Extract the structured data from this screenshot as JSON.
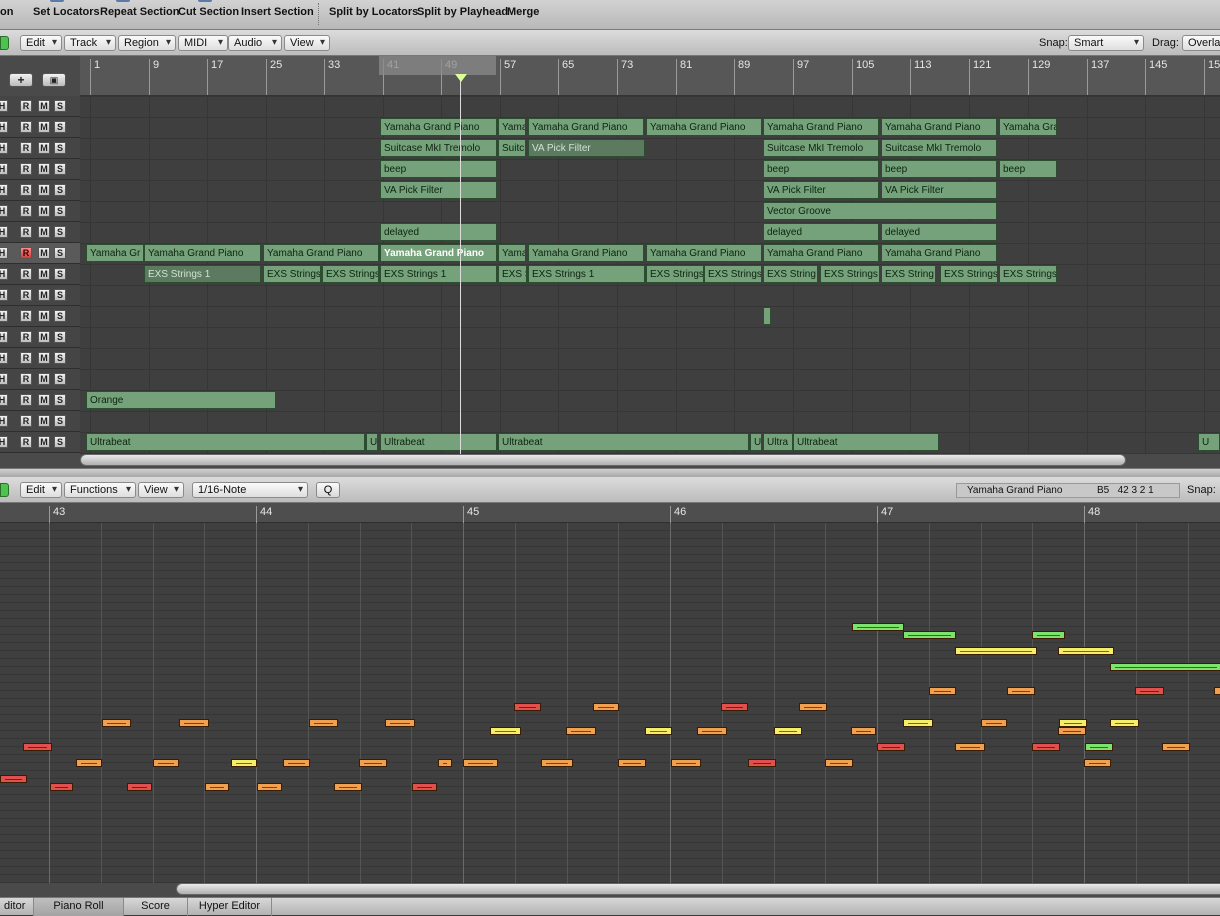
{
  "toolbar": {
    "items": [
      "on",
      "Set Locators",
      "Repeat Section",
      "Cut Section",
      "Insert Section",
      "Split by Locators",
      "Split by Playhead",
      "Merge"
    ]
  },
  "arrange_bar": {
    "menus": [
      "Edit",
      "Track",
      "Region",
      "MIDI",
      "Audio",
      "View"
    ],
    "snap_label": "Snap:",
    "snap_value": "Smart",
    "drag_label": "Drag:",
    "drag_value": "Overlap"
  },
  "ruler": {
    "bars": [
      "1",
      "9",
      "17",
      "25",
      "33",
      "41",
      "49",
      "57",
      "65",
      "73",
      "81",
      "89",
      "97",
      "105",
      "113",
      "121",
      "129",
      "137",
      "145",
      "15"
    ]
  },
  "track_buttons": {
    "h": "H",
    "r": "R",
    "m": "M",
    "s": "S"
  },
  "regions": [
    {
      "row": 1,
      "name": "Yamaha Grand Piano"
    },
    {
      "row": 1,
      "name": "Yama"
    },
    {
      "row": 1,
      "name": "Yamaha Grand Piano"
    },
    {
      "row": 1,
      "name": "Yamaha Grand Piano"
    },
    {
      "row": 1,
      "name": "Yamaha Grand Piano"
    },
    {
      "row": 1,
      "name": "Yamaha Grand Piano"
    },
    {
      "row": 1,
      "name": "Yamaha Gra"
    },
    {
      "row": 2,
      "name": "Suitcase MkI Tremolo"
    },
    {
      "row": 2,
      "name": "Suitc"
    },
    {
      "row": 2,
      "name": "VA Pick Filter"
    },
    {
      "row": 2,
      "name": "Suitcase MkI Tremolo"
    },
    {
      "row": 2,
      "name": "Suitcase MkI Tremolo"
    },
    {
      "row": 3,
      "name": "beep"
    },
    {
      "row": 3,
      "name": "beep"
    },
    {
      "row": 3,
      "name": "beep"
    },
    {
      "row": 3,
      "name": "beep"
    },
    {
      "row": 4,
      "name": "VA Pick Filter"
    },
    {
      "row": 4,
      "name": "VA Pick Filter"
    },
    {
      "row": 4,
      "name": "VA Pick Filter"
    },
    {
      "row": 5,
      "name": "Vector Groove"
    },
    {
      "row": 6,
      "name": "delayed"
    },
    {
      "row": 6,
      "name": "delayed"
    },
    {
      "row": 6,
      "name": "delayed"
    },
    {
      "row": 7,
      "name": "Yamaha Gr"
    },
    {
      "row": 7,
      "name": "Yamaha Grand Piano"
    },
    {
      "row": 7,
      "name": "Yamaha Grand Piano"
    },
    {
      "row": 7,
      "name": "Yamaha Grand Piano"
    },
    {
      "row": 7,
      "name": "Yama"
    },
    {
      "row": 7,
      "name": "Yamaha Grand Piano"
    },
    {
      "row": 7,
      "name": "Yamaha Grand Piano"
    },
    {
      "row": 7,
      "name": "Yamaha Grand Piano"
    },
    {
      "row": 7,
      "name": "Yamaha Grand Piano"
    },
    {
      "row": 8,
      "name": "EXS Strings 1"
    },
    {
      "row": 8,
      "name": "EXS Strings"
    },
    {
      "row": 8,
      "name": "EXS Strings"
    },
    {
      "row": 8,
      "name": "EXS Strings 1"
    },
    {
      "row": 8,
      "name": "EXS S"
    },
    {
      "row": 8,
      "name": "EXS Strings 1"
    },
    {
      "row": 8,
      "name": "EXS Strings"
    },
    {
      "row": 8,
      "name": "EXS Strings"
    },
    {
      "row": 8,
      "name": "EXS String"
    },
    {
      "row": 8,
      "name": "EXS Strings"
    },
    {
      "row": 8,
      "name": "EXS String"
    },
    {
      "row": 8,
      "name": "EXS Strings"
    },
    {
      "row": 8,
      "name": "EXS Strings"
    },
    {
      "row": 10,
      "name": ""
    },
    {
      "row": 14,
      "name": "Orange"
    },
    {
      "row": 16,
      "name": "Ultrabeat"
    },
    {
      "row": 16,
      "name": "U"
    },
    {
      "row": 16,
      "name": "Ultrabeat"
    },
    {
      "row": 16,
      "name": "Ultrabeat"
    },
    {
      "row": 16,
      "name": "U"
    },
    {
      "row": 16,
      "name": "Ultra"
    },
    {
      "row": 16,
      "name": "Ultrabeat"
    },
    {
      "row": 16,
      "name": "U"
    }
  ],
  "piano_bar": {
    "menus": [
      "Edit",
      "Functions",
      "View"
    ],
    "quantize_value": "1/16-Note",
    "q_button": "Q",
    "region_name": "Yamaha Grand Piano",
    "pitch_pos": "B5   42 3 2 1",
    "snap_label": "Snap:"
  },
  "piano_ruler": {
    "bars": [
      "43",
      "44",
      "45",
      "46",
      "47",
      "48"
    ]
  },
  "colors": {
    "red": "#e0504e",
    "orange": "#f0a050",
    "yellow": "#f4ee6a",
    "green": "#7ee36e"
  },
  "notes": [
    {
      "color": "red"
    },
    {
      "color": "red"
    },
    {
      "color": "red"
    },
    {
      "color": "red"
    },
    {
      "color": "red"
    },
    {
      "color": "red"
    },
    {
      "color": "red"
    },
    {
      "color": "red"
    },
    {
      "color": "red"
    },
    {
      "color": "red"
    },
    {
      "color": "red"
    },
    {
      "color": "orange"
    },
    {
      "color": "orange"
    },
    {
      "color": "orange"
    },
    {
      "color": "orange"
    },
    {
      "color": "orange"
    },
    {
      "color": "orange"
    },
    {
      "color": "orange"
    },
    {
      "color": "orange"
    },
    {
      "color": "orange"
    },
    {
      "color": "orange"
    },
    {
      "color": "orange"
    },
    {
      "color": "orange"
    },
    {
      "color": "orange"
    },
    {
      "color": "orange"
    },
    {
      "color": "orange"
    },
    {
      "color": "orange"
    },
    {
      "color": "orange"
    },
    {
      "color": "orange"
    },
    {
      "color": "orange"
    },
    {
      "color": "orange"
    },
    {
      "color": "orange"
    },
    {
      "color": "orange"
    },
    {
      "color": "orange"
    },
    {
      "color": "orange"
    },
    {
      "color": "orange"
    },
    {
      "color": "orange"
    },
    {
      "color": "orange"
    },
    {
      "color": "orange"
    },
    {
      "color": "orange"
    },
    {
      "color": "orange"
    },
    {
      "color": "orange"
    },
    {
      "color": "yellow"
    },
    {
      "color": "yellow"
    },
    {
      "color": "yellow"
    },
    {
      "color": "yellow"
    },
    {
      "color": "yellow"
    },
    {
      "color": "yellow"
    },
    {
      "color": "yellow"
    },
    {
      "color": "yellow"
    },
    {
      "color": "yellow"
    },
    {
      "color": "green"
    },
    {
      "color": "green"
    },
    {
      "color": "green"
    },
    {
      "color": "green"
    },
    {
      "color": "green"
    }
  ],
  "bottom_tabs": [
    "ditor",
    "Piano Roll",
    "Score",
    "Hyper Editor"
  ]
}
